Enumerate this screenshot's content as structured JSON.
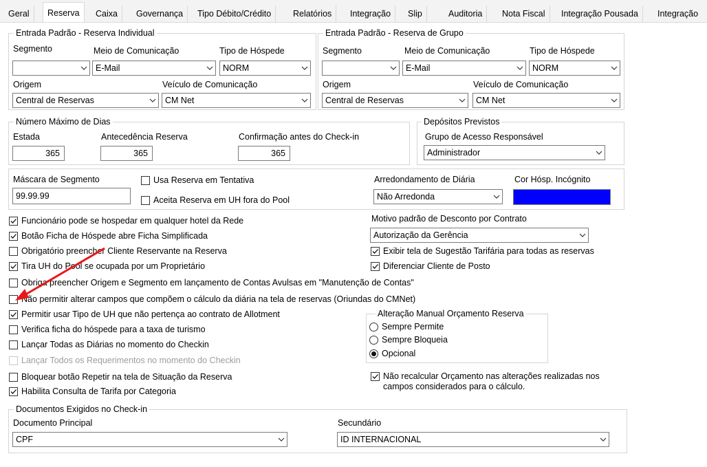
{
  "tabs": [
    "Geral",
    "Reserva",
    "Caixa",
    "Governança",
    "Tipo Débito/Crédito",
    "Relatórios",
    "Integração",
    "Slip",
    "Auditoria",
    "Nota Fiscal",
    "Integração Pousada",
    "Integração"
  ],
  "individual": {
    "title": "Entrada Padrão - Reserva Individual",
    "segmento_label": "Segmento",
    "segmento_value": "",
    "meio_label": "Meio de Comunicação",
    "meio_value": "E-Mail",
    "tipo_label": "Tipo de Hóspede",
    "tipo_value": "NORM",
    "origem_label": "Origem",
    "origem_value": "Central de Reservas",
    "veiculo_label": "Veículo de Comunicação",
    "veiculo_value": "CM Net"
  },
  "grupo": {
    "title": "Entrada Padrão - Reserva de Grupo",
    "segmento_label": "Segmento",
    "segmento_value": "",
    "meio_label": "Meio de Comunicação",
    "meio_value": "E-Mail",
    "tipo_label": "Tipo de Hóspede",
    "tipo_value": "NORM",
    "origem_label": "Origem",
    "origem_value": "Central de Reservas",
    "veiculo_label": "Veículo de Comunicação",
    "veiculo_value": "CM Net"
  },
  "dias": {
    "title": "Número Máximo de Dias",
    "estada_label": "Estada",
    "estada_value": "365",
    "antecedencia_label": "Antecedência Reserva",
    "antecedencia_value": "365",
    "confirmacao_label": "Confirmação antes do Check-in",
    "confirmacao_value": "365"
  },
  "depositos": {
    "title": "Depósitos Previstos",
    "grupo_label": "Grupo de Acesso Responsável",
    "grupo_value": "Administrador"
  },
  "mascara": {
    "label": "Máscara de Segmento",
    "value": "99.99.99",
    "cb_tentativa": "Usa Reserva em Tentativa",
    "cb_pool": "Aceita Reserva em UH fora do Pool",
    "arred_label": "Arredondamento de Diária",
    "arred_value": "Não Arredonda",
    "cor_label": "Cor Hósp. Incógnito",
    "cor_color": "#0000ff"
  },
  "checks": [
    {
      "label": "Funcionário pode se hospedar em qualquer hotel da Rede",
      "checked": true
    },
    {
      "label": "Botão Ficha de Hóspede abre Ficha Simplificada",
      "checked": true
    },
    {
      "label": "Obrigatório preencher Cliente Reservante na Reserva",
      "checked": false
    },
    {
      "label": "Tira UH do Pool se ocupada por um Proprietário",
      "checked": true
    },
    {
      "label": "Obriga preencher Origem e Segmento em lançamento de Contas Avulsas em \"Manutenção de Contas\"",
      "checked": false
    },
    {
      "label": "Não permitir alterar campos que compõem o cálculo da diária na tela de reservas (Oriundas do CMNet)",
      "checked": false
    },
    {
      "label": "Permitir usar Tipo de UH que não pertença ao contrato de Allotment",
      "checked": true
    },
    {
      "label": "Verifica ficha do hóspede para a taxa de turismo",
      "checked": false
    },
    {
      "label": "Lançar Todas as Diárias no momento do Checkin",
      "checked": false
    },
    {
      "label": "Lançar Todos os Requerimentos no momento do Checkin",
      "checked": false
    },
    {
      "label": "Bloquear botão Repetir na tela de Situação da Reserva",
      "checked": false
    },
    {
      "label": "Habilita Consulta de Tarifa por Categoria",
      "checked": true
    }
  ],
  "desconto": {
    "label": "Motivo padrão de Desconto por Contrato",
    "value": "Autorização da Gerência"
  },
  "right_checks": [
    {
      "label": "Exibir tela de Sugestão Tarifária para todas as reservas",
      "checked": true
    },
    {
      "label": "Diferenciar Cliente de Posto",
      "checked": true
    }
  ],
  "orcamento": {
    "title": "Alteração Manual Orçamento Reserva",
    "options": [
      "Sempre Permite",
      "Sempre Bloqueia",
      "Opcional"
    ],
    "selected": 2
  },
  "recalc": {
    "line1": "Não recalcular Orçamento nas alterações realizadas nos",
    "line2": "campos considerados para o cálculo.",
    "checked": true
  },
  "documentos": {
    "title": "Documentos Exigidos no Check-in",
    "principal_label": "Documento Principal",
    "principal_value": "CPF",
    "secundario_label": "Secundário",
    "secundario_value": "ID INTERNACIONAL"
  },
  "annotation_color": "#e8171b"
}
